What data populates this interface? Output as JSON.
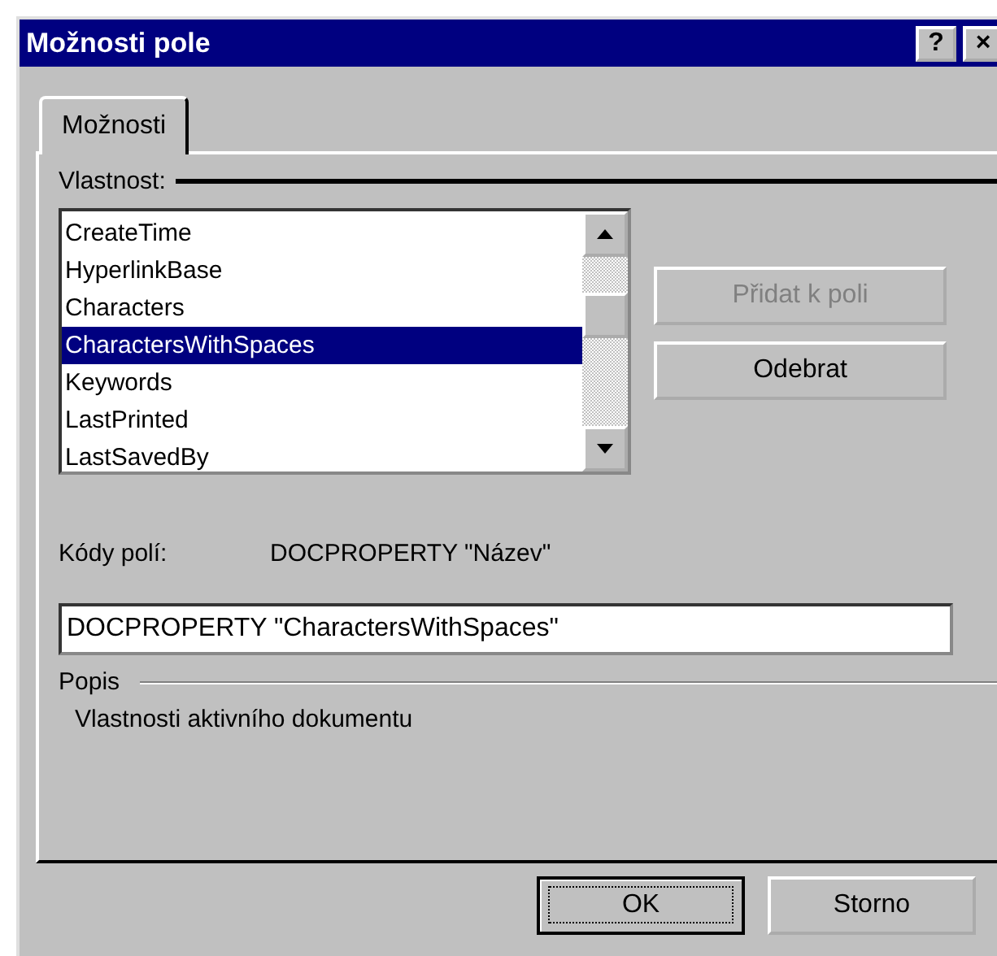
{
  "window": {
    "title": "Možnosti pole",
    "help_button": "?",
    "close_button": "×"
  },
  "tabs": [
    {
      "label": "Možnosti",
      "selected": true
    }
  ],
  "property_label": "Vlastnost:",
  "properties": [
    {
      "label": "CreateTime",
      "selected": false
    },
    {
      "label": "HyperlinkBase",
      "selected": false
    },
    {
      "label": "Characters",
      "selected": false
    },
    {
      "label": "CharactersWithSpaces",
      "selected": true
    },
    {
      "label": "Keywords",
      "selected": false
    },
    {
      "label": "LastPrinted",
      "selected": false
    },
    {
      "label": "LastSavedBy",
      "selected": false
    }
  ],
  "side_buttons": [
    {
      "label": "Přidat k poli",
      "disabled": true
    },
    {
      "label": "Odebrat",
      "disabled": false
    }
  ],
  "field_codes": {
    "label": "Kódy polí:",
    "value": "DOCPROPERTY \"Název\""
  },
  "code_input": {
    "value": "DOCPROPERTY \"CharactersWithSpaces\""
  },
  "description": {
    "label": "Popis",
    "text": "Vlastnosti aktivního dokumentu"
  },
  "buttons": [
    {
      "label": "OK",
      "default": true
    },
    {
      "label": "Storno",
      "default": false
    }
  ]
}
